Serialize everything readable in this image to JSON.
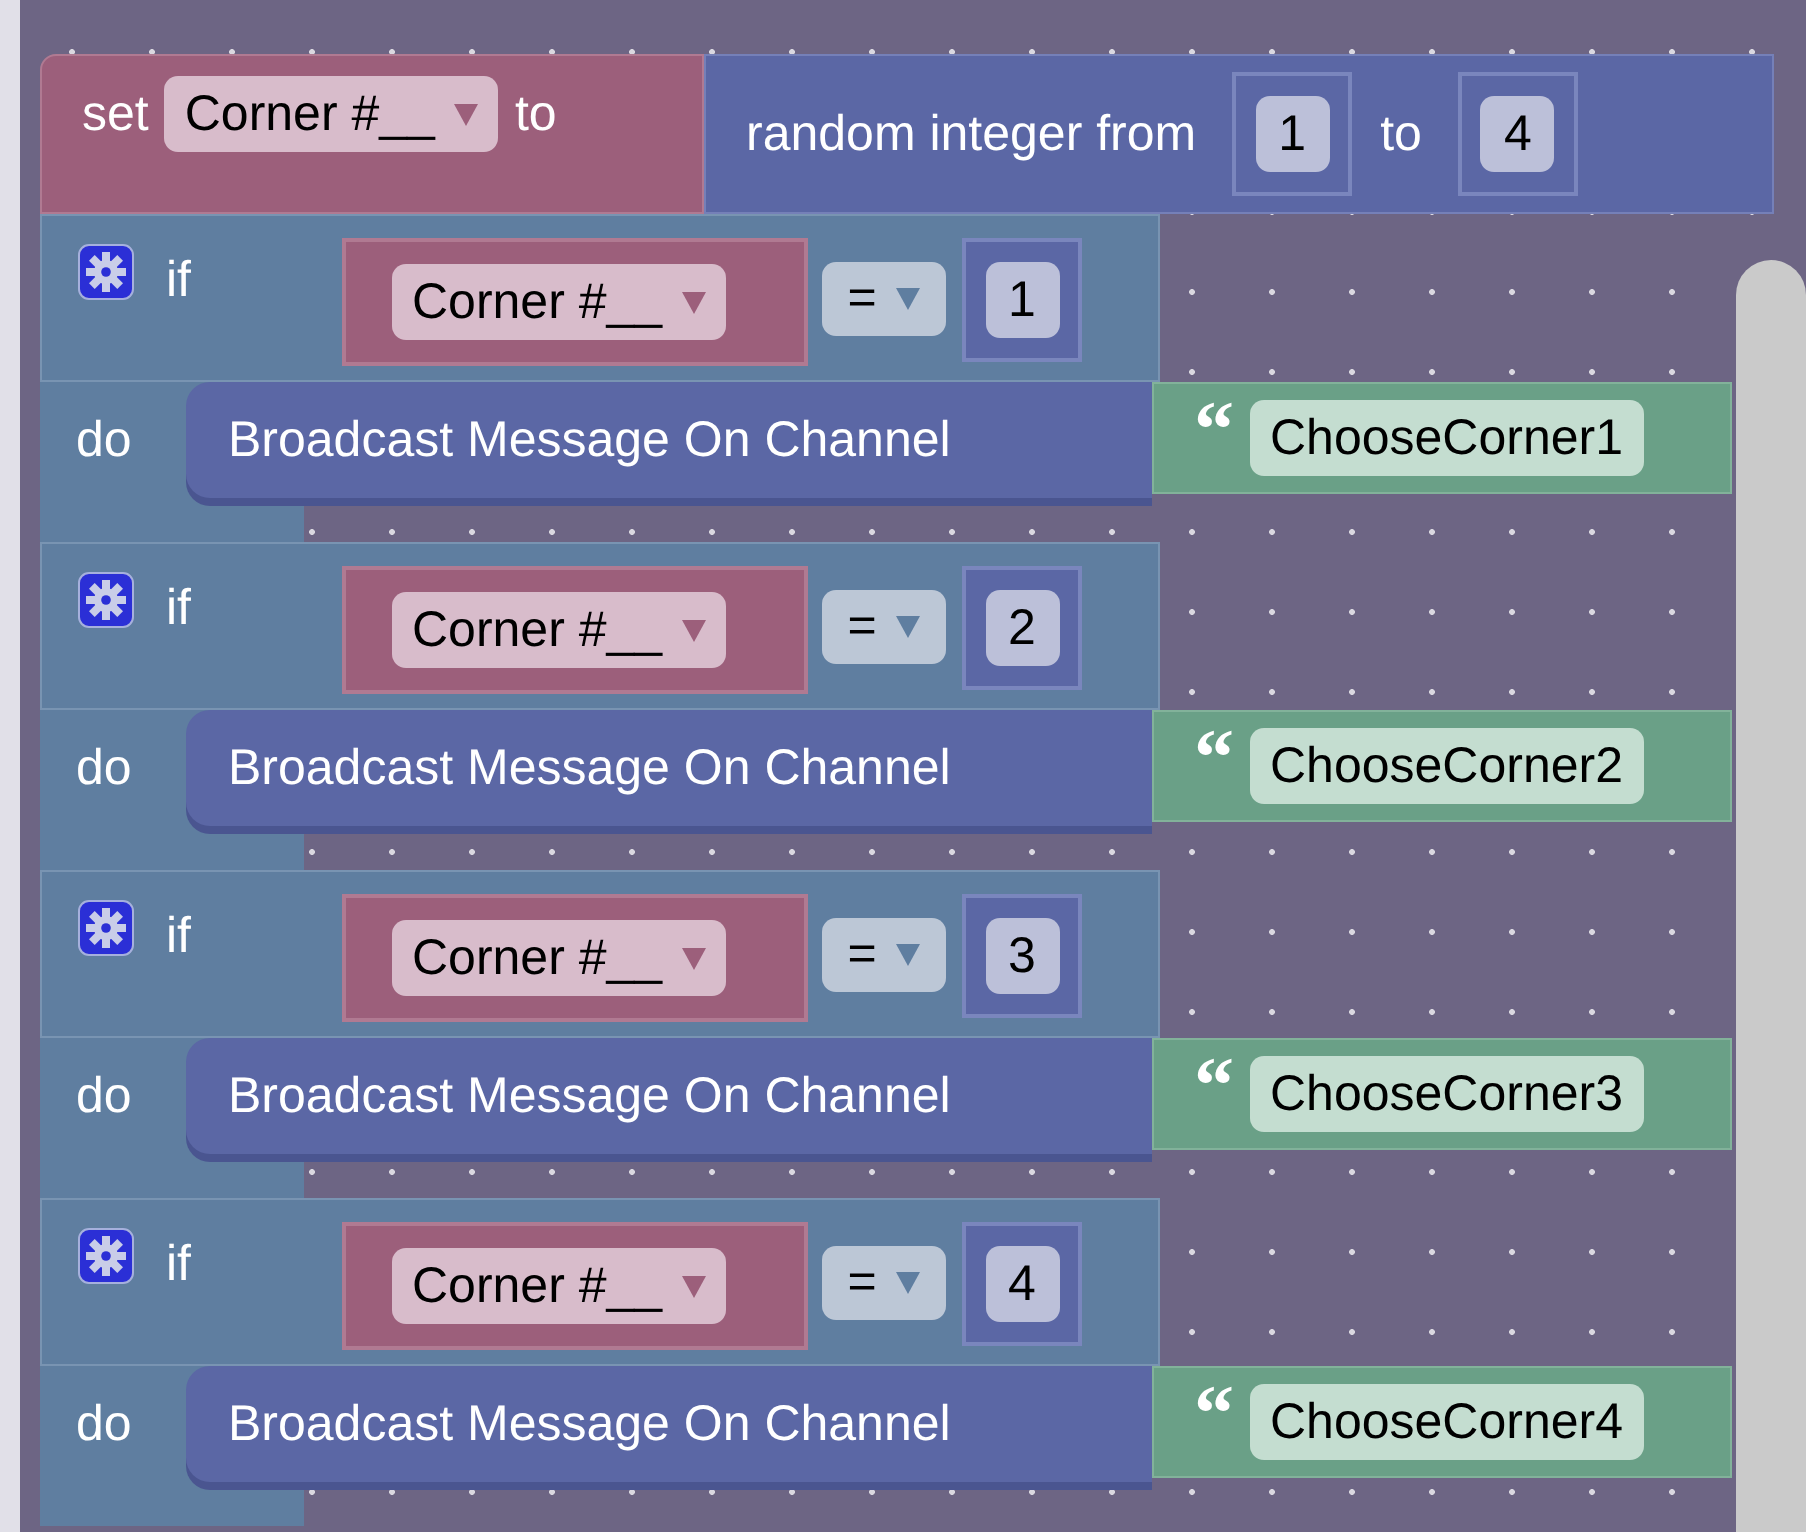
{
  "set_block": {
    "label": "set",
    "variable": "Corner #__",
    "to_label": "to",
    "value": {
      "label": "random integer from",
      "from": "1",
      "to_label": "to",
      "to": "4"
    }
  },
  "if_blocks": [
    {
      "if_label": "if",
      "variable": "Corner #__",
      "operator": "=",
      "number": "1",
      "do_label": "do",
      "action": "Broadcast Message On Channel",
      "quote": "“",
      "message": "ChooseCorner1"
    },
    {
      "if_label": "if",
      "variable": "Corner #__",
      "operator": "=",
      "number": "2",
      "do_label": "do",
      "action": "Broadcast Message On Channel",
      "quote": "“",
      "message": "ChooseCorner2"
    },
    {
      "if_label": "if",
      "variable": "Corner #__",
      "operator": "=",
      "number": "3",
      "do_label": "do",
      "action": "Broadcast Message On Channel",
      "quote": "“",
      "message": "ChooseCorner3"
    },
    {
      "if_label": "if",
      "variable": "Corner #__",
      "operator": "=",
      "number": "4",
      "do_label": "do",
      "action": "Broadcast Message On Channel",
      "quote": "“",
      "message": "ChooseCorner4"
    }
  ]
}
